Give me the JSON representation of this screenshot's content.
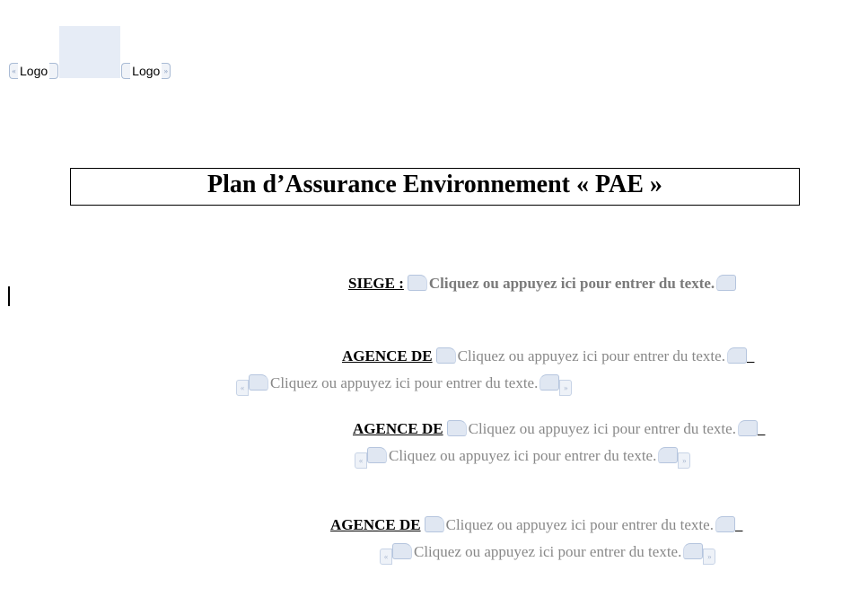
{
  "header": {
    "logo_left": "Logo",
    "logo_right": "Logo"
  },
  "title": "Plan d’Assurance Environnement « PAE »",
  "fields": {
    "siege_label": "SIEGE",
    "siege_colon": " :",
    "agence_label": "AGENCE DE",
    "placeholder_text": "Cliquez ou appuyez ici pour entrer du texte."
  },
  "content_controls": {
    "open_glyph": "«",
    "close_glyph": "»"
  }
}
